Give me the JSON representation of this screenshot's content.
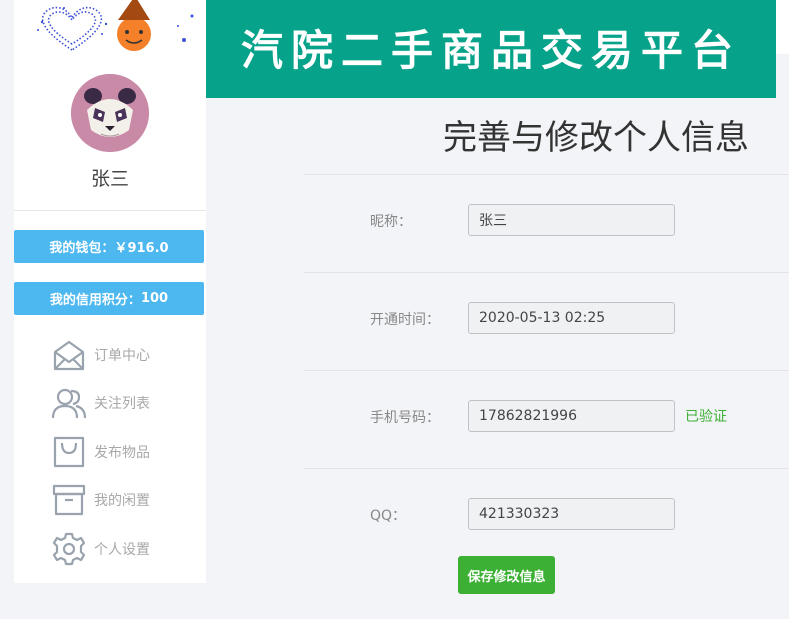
{
  "header": {
    "title": "汽院二手商品交易平台",
    "banner_color": "#06a38a"
  },
  "sidebar": {
    "avatar_icon": "panda-avatar",
    "username": "张三",
    "wallet": {
      "label": "我的钱包：",
      "value": "￥916.0"
    },
    "credit": {
      "label": "我的信用积分：",
      "value": "100"
    },
    "button_color": "#4db7f0",
    "menu": [
      {
        "label": "订单中心",
        "icon": "envelope-icon"
      },
      {
        "label": "关注列表",
        "icon": "users-icon"
      },
      {
        "label": "发布物品",
        "icon": "shopping-bag-icon"
      },
      {
        "label": "我的闲置",
        "icon": "archive-box-icon"
      },
      {
        "label": "个人设置",
        "icon": "gear-icon"
      }
    ]
  },
  "main": {
    "page_title": "完善与修改个人信息",
    "fields": [
      {
        "label": "昵称：",
        "value": "张三"
      },
      {
        "label": "开通时间：",
        "value": "2020-05-13 02:25"
      },
      {
        "label": "手机号码：",
        "value": "17862821996"
      },
      {
        "label": "QQ：",
        "value": "421330323"
      }
    ],
    "phone_status": "已验证",
    "save_label": "保存修改信息",
    "accent_color": "#3cb034"
  }
}
